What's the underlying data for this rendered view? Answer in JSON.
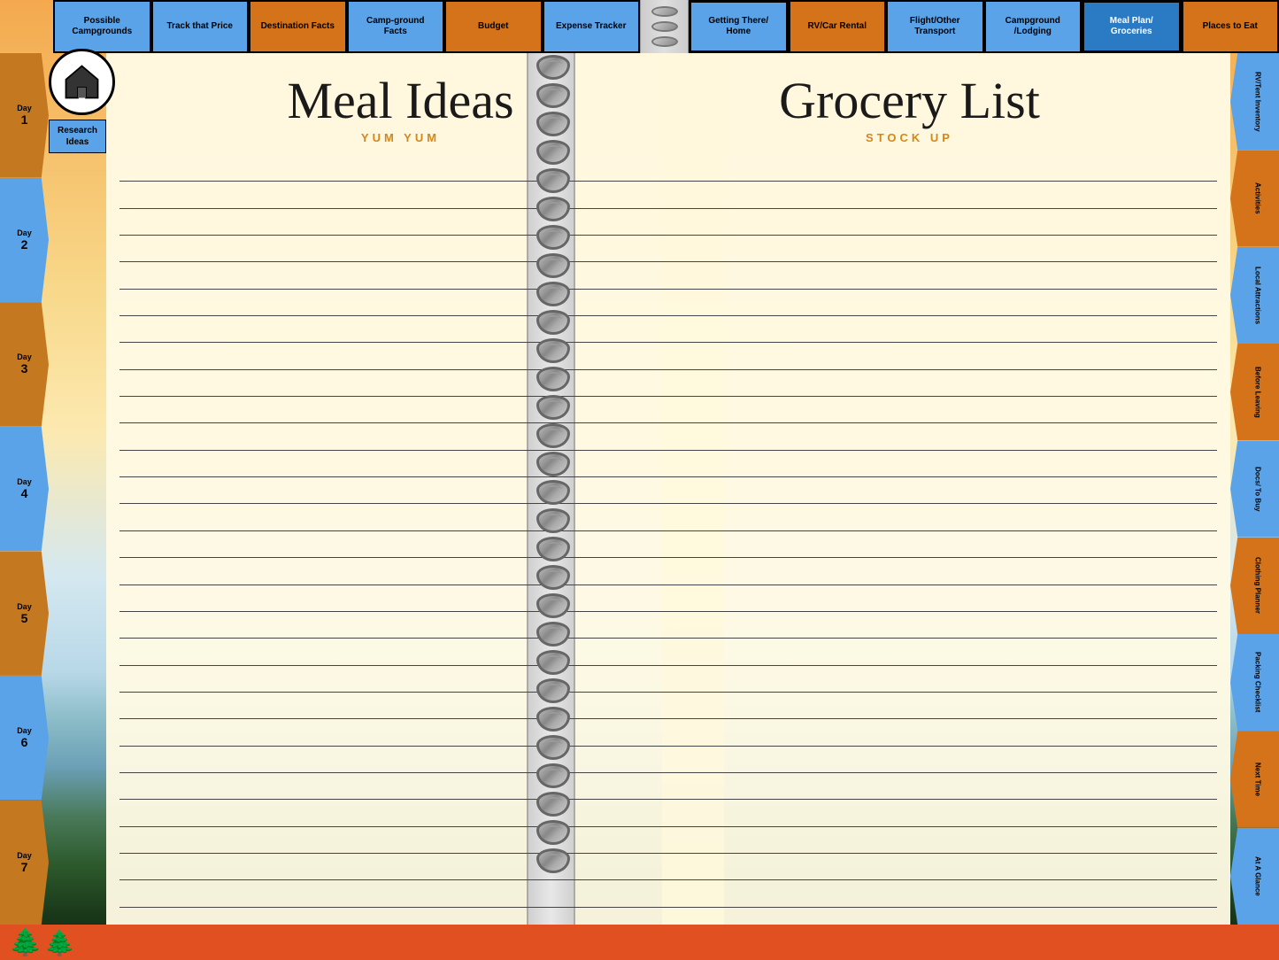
{
  "page": {
    "title": "Meal Plan / Groceries",
    "left_title": "Meal Ideas",
    "left_subtitle": "YUM YUM",
    "right_title": "Grocery List",
    "right_subtitle": "STOCK UP"
  },
  "top_nav": {
    "tabs": [
      {
        "label": "Possible Campgrounds",
        "color": "blue"
      },
      {
        "label": "Track that Price",
        "color": "blue"
      },
      {
        "label": "Destination Facts",
        "color": "orange"
      },
      {
        "label": "Camp-ground Facts",
        "color": "blue"
      },
      {
        "label": "Budget",
        "color": "orange"
      },
      {
        "label": "Expense Tracker",
        "color": "blue"
      },
      {
        "label": "Getting There/ Home",
        "color": "blue"
      },
      {
        "label": "RV/Car Rental",
        "color": "orange"
      },
      {
        "label": "Flight/Other Transport",
        "color": "blue"
      },
      {
        "label": "Campground /Lodging",
        "color": "blue"
      },
      {
        "label": "Meal Plan/ Groceries",
        "color": "blue"
      },
      {
        "label": "Places to Eat",
        "color": "orange"
      }
    ]
  },
  "left_tabs": [
    {
      "label": "Day",
      "num": "1",
      "color": "brown"
    },
    {
      "label": "Day",
      "num": "2",
      "color": "blue"
    },
    {
      "label": "Day",
      "num": "3",
      "color": "brown"
    },
    {
      "label": "Day",
      "num": "4",
      "color": "blue"
    },
    {
      "label": "Day",
      "num": "5",
      "color": "brown"
    },
    {
      "label": "Day",
      "num": "6",
      "color": "blue"
    },
    {
      "label": "Day",
      "num": "7",
      "color": "brown"
    }
  ],
  "right_tabs": [
    {
      "label": "RV/Tent Inventory",
      "color": "blue"
    },
    {
      "label": "Activities",
      "color": "orange"
    },
    {
      "label": "Local Attractions",
      "color": "blue"
    },
    {
      "label": "Before Leaving",
      "color": "orange"
    },
    {
      "label": "Docs/ To Buy",
      "color": "blue"
    },
    {
      "label": "Clothing Planner",
      "color": "orange"
    },
    {
      "label": "Packing Checklist",
      "color": "blue"
    },
    {
      "label": "Next Time",
      "color": "orange"
    },
    {
      "label": "At A Glance",
      "color": "blue"
    }
  ],
  "home_icon": "🏠",
  "research_tab": "Research Ideas",
  "bottom_trees": "🌲🌲",
  "line_count": 28
}
